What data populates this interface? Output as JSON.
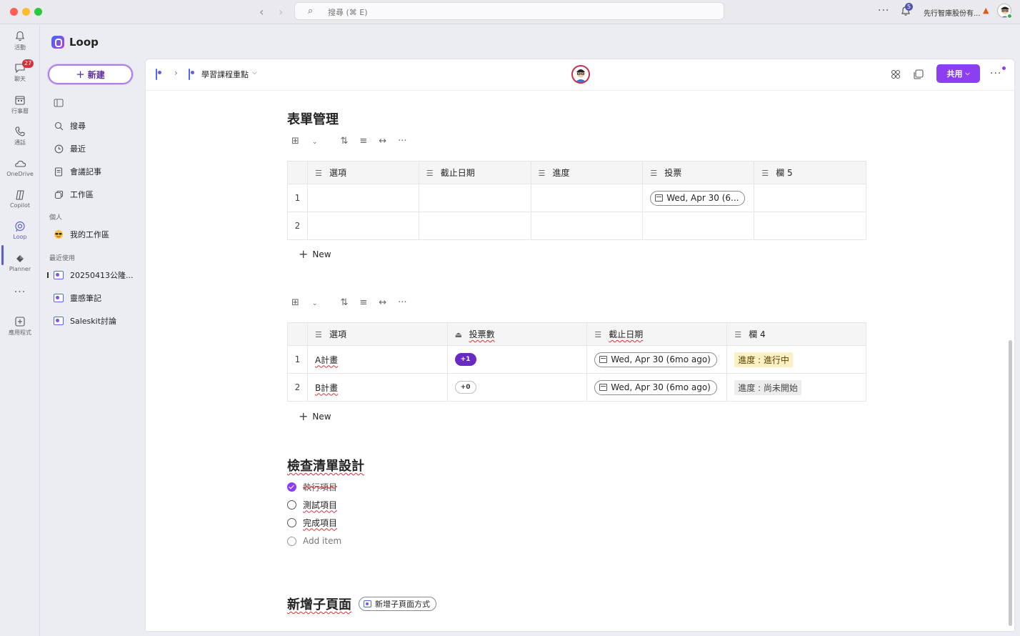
{
  "titlebar": {
    "search_placeholder": "搜尋 (⌘ E)",
    "more": "···",
    "notification_count": "5",
    "org_name": "先行智庫股份有...",
    "warning": "▲"
  },
  "rail": {
    "items": [
      {
        "label": "活動",
        "icon": "bell-icon"
      },
      {
        "label": "聊天",
        "icon": "chat-icon",
        "badge": "27"
      },
      {
        "label": "行事曆",
        "icon": "calendar-icon"
      },
      {
        "label": "通話",
        "icon": "phone-icon"
      },
      {
        "label": "OneDrive",
        "icon": "cloud-icon"
      },
      {
        "label": "Copilot",
        "icon": "copilot-icon"
      },
      {
        "label": "Loop",
        "icon": "loop-icon",
        "active": true
      },
      {
        "label": "Planner",
        "icon": "planner-icon"
      },
      {
        "label": "···",
        "icon": "more-icon"
      },
      {
        "label": "應用程式",
        "icon": "add-apps-icon"
      }
    ]
  },
  "sidebar": {
    "brand": "Loop",
    "new_button": "新建",
    "nav": [
      {
        "label": "搜尋",
        "icon": "search-icon"
      },
      {
        "label": "最近",
        "icon": "clock-icon"
      },
      {
        "label": "會議記事",
        "icon": "notes-icon"
      },
      {
        "label": "工作區",
        "icon": "workspaces-icon"
      }
    ],
    "personal_section": "個人",
    "personal_item": "我的工作區",
    "recent_section": "最近使用",
    "recent_items": [
      "20250413公隆...",
      "靈感筆記",
      "Saleskit討論"
    ]
  },
  "topbar": {
    "page_title": "學習課程重點",
    "share_button": "共用",
    "more": "···"
  },
  "content": {
    "heading_form": "表單管理",
    "toolbar": {
      "table": "⊞",
      "chevron": "⌄",
      "sort": "⇅",
      "filter": "≡",
      "width": "↔",
      "more": "···"
    },
    "table1": {
      "headers": [
        "選項",
        "截止日期",
        "進度",
        "投票",
        "欄 5"
      ],
      "rows": [
        {
          "num": "1",
          "cells": [
            "",
            "",
            "",
            "Wed, Apr 30 (6...",
            ""
          ]
        },
        {
          "num": "2",
          "cells": [
            "",
            "",
            "",
            "",
            ""
          ]
        }
      ]
    },
    "new_label": "New",
    "table2": {
      "headers": [
        "選項",
        "投票數",
        "截止日期",
        "欄 4"
      ],
      "rows": [
        {
          "num": "1",
          "option": "A計畫",
          "votes": "+1",
          "date": "Wed, Apr 30 (6mo ago)",
          "status": "進度 : 進行中"
        },
        {
          "num": "2",
          "option": "B計畫",
          "votes": "+0",
          "date": "Wed, Apr 30 (6mo ago)",
          "status": "進度 : 尚未開始"
        }
      ]
    },
    "heading_checklist": "檢查清單設計",
    "checklist": [
      {
        "label": "執行項目",
        "checked": true
      },
      {
        "label": "測試項目",
        "checked": false
      },
      {
        "label": "完成項目",
        "checked": false
      }
    ],
    "add_item": "Add item",
    "heading_subpage": "新增子頁面",
    "subpage_link": "新增子頁面方式"
  },
  "colors": {
    "accent": "#8b3ff0",
    "vote_active": "#6929c4",
    "status_in_progress_bg": "#fbf1c5",
    "status_not_started_bg": "#ededed",
    "badge_red": "#d13438"
  }
}
